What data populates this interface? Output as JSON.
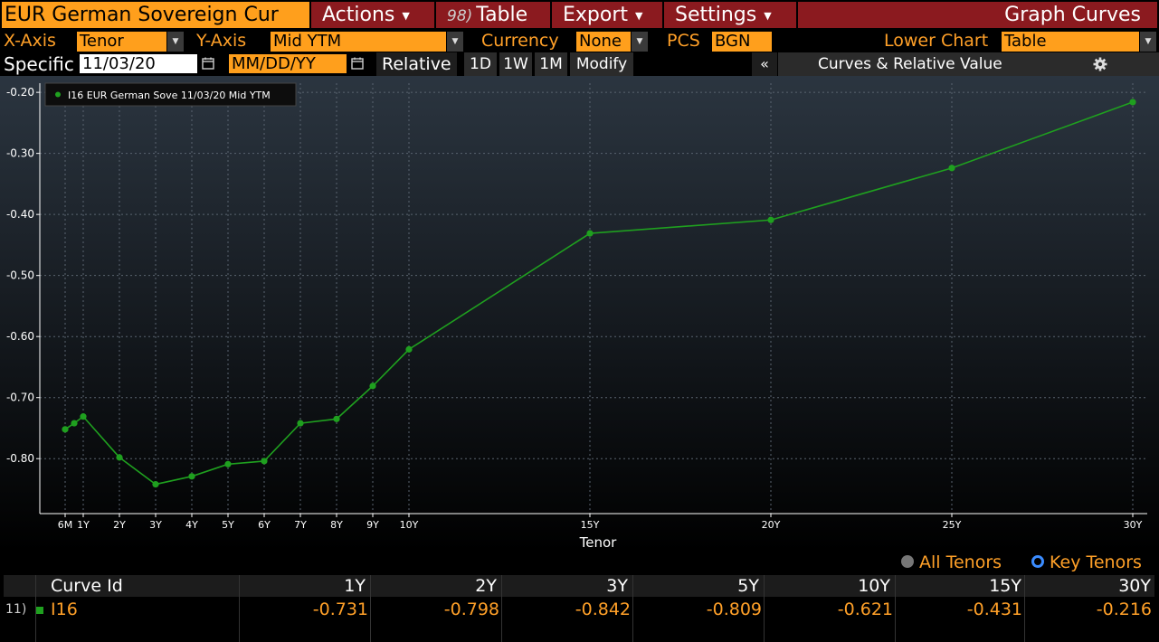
{
  "toolbar": {
    "title": "EUR German Sovereign Cur",
    "actions_label": "Actions",
    "table_num": "98)",
    "table_label": "Table",
    "export_label": "Export",
    "settings_label": "Settings",
    "graph_curves_label": "Graph Curves"
  },
  "selectors": {
    "x_axis_label": "X-Axis",
    "x_axis_value": "Tenor",
    "y_axis_label": "Y-Axis",
    "y_axis_value": "Mid YTM",
    "currency_label": "Currency",
    "currency_value": "None",
    "pcs_label": "PCS",
    "pcs_value": "BGN",
    "lower_chart_label": "Lower Chart",
    "lower_chart_value": "Table"
  },
  "dates": {
    "specific_label": "Specific",
    "specific_date": "11/03/20",
    "compare_placeholder": "MM/DD/YY",
    "relative_label": "Relative",
    "btn_1d": "1D",
    "btn_1w": "1W",
    "btn_1m": "1M",
    "modify_label": "Modify",
    "collapse_label": "«",
    "panel_title": "Curves & Relative Value"
  },
  "colors": {
    "orange": "#ff9f1c",
    "menu_red": "#8b1a1f",
    "series_green": "#1fa01f"
  },
  "chart_data": {
    "type": "line",
    "xlabel": "Tenor",
    "ylabel": "",
    "x_ticks": [
      "6M",
      "1Y",
      "2Y",
      "3Y",
      "4Y",
      "5Y",
      "6Y",
      "7Y",
      "8Y",
      "9Y",
      "10Y",
      "15Y",
      "20Y",
      "25Y",
      "30Y"
    ],
    "y_ticks": [
      "-0.20",
      "-0.30",
      "-0.40",
      "-0.50",
      "-0.60",
      "-0.70",
      "-0.80"
    ],
    "ylim": [
      -0.89,
      -0.185
    ],
    "grid": true,
    "legend": "top-left",
    "series": [
      {
        "name": "I16 EUR German Sove 11/03/20 Mid YTM",
        "x": [
          0.5,
          0.75,
          1,
          2,
          3,
          4,
          5,
          6,
          7,
          8,
          9,
          10,
          15,
          20,
          25,
          30
        ],
        "y": [
          -0.752,
          -0.742,
          -0.731,
          -0.798,
          -0.842,
          -0.829,
          -0.809,
          -0.804,
          -0.742,
          -0.735,
          -0.681,
          -0.621,
          -0.431,
          -0.409,
          -0.324,
          -0.216
        ]
      }
    ]
  },
  "tenor_toggle": {
    "all_label": "All Tenors",
    "key_label": "Key Tenors"
  },
  "table": {
    "headers": [
      "Curve Id",
      "1Y",
      "2Y",
      "3Y",
      "5Y",
      "10Y",
      "15Y",
      "30Y"
    ],
    "rows": [
      {
        "num": "11)",
        "curve_id": "I16",
        "values": [
          "-0.731",
          "-0.798",
          "-0.842",
          "-0.809",
          "-0.621",
          "-0.431",
          "-0.216"
        ]
      }
    ]
  }
}
